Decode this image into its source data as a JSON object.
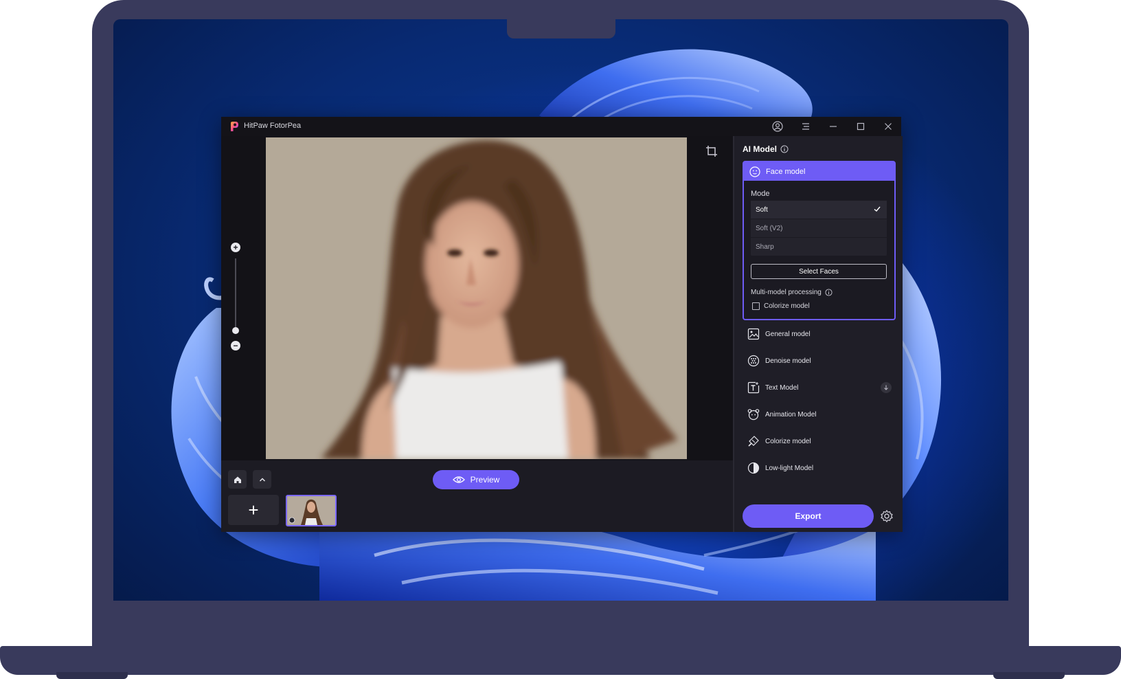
{
  "window": {
    "title": "HitPaw FotorPea"
  },
  "canvas": {
    "zoom_in_symbol": "+",
    "zoom_out_symbol": "−",
    "zoom_level": 0.05
  },
  "bottom_bar": {
    "preview_label": "Preview",
    "add_symbol": "+"
  },
  "panel": {
    "title": "AI Model",
    "face_model": {
      "label": "Face model",
      "mode_label": "Mode",
      "modes": [
        {
          "label": "Soft",
          "selected": true
        },
        {
          "label": "Soft (V2)",
          "selected": false
        },
        {
          "label": "Sharp",
          "selected": false
        }
      ],
      "select_faces_label": "Select Faces",
      "multi_model_label": "Multi-model processing",
      "colorize_checkbox_label": "Colorize model",
      "colorize_checked": false
    },
    "models": [
      {
        "label": "General model",
        "icon": "image-icon"
      },
      {
        "label": "Denoise model",
        "icon": "denoise-icon"
      },
      {
        "label": "Text Model",
        "icon": "text-icon",
        "download": true
      },
      {
        "label": "Animation Model",
        "icon": "animation-icon"
      },
      {
        "label": "Colorize model",
        "icon": "colorize-icon"
      },
      {
        "label": "Low-light Model",
        "icon": "lowlight-icon"
      }
    ],
    "export_label": "Export"
  },
  "colors": {
    "accent": "#6e5cf5",
    "window_bg": "#19181f",
    "panel_bg": "#1f1e27",
    "laptop_frame": "#393a5c"
  }
}
